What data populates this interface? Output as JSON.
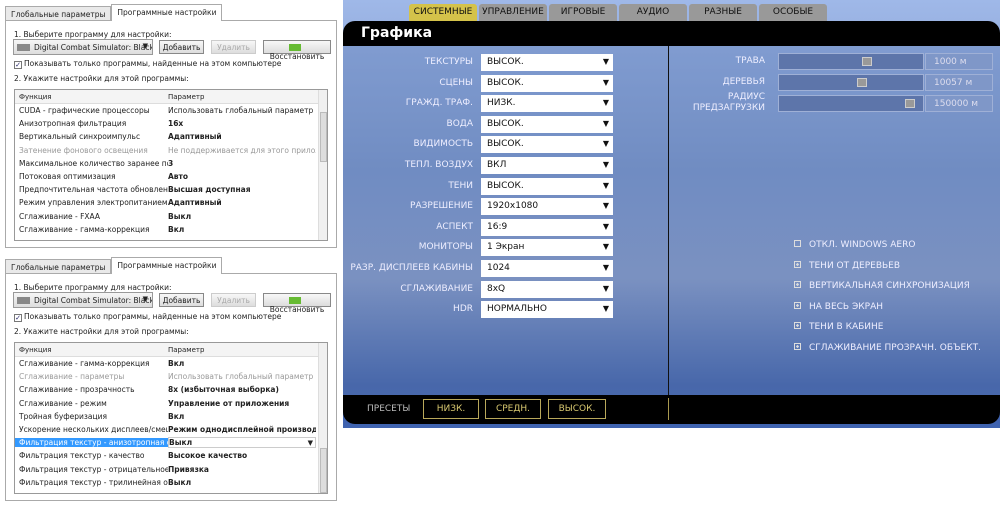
{
  "nvidia_panels": [
    {
      "tabs": [
        "Глобальные параметры",
        "Программные настройки"
      ],
      "step1": "1. Выберите программу для настройки:",
      "program": "Digital Combat Simulator: Black ...",
      "add": "Добавить",
      "remove": "Удалить",
      "restore": "Восстановить",
      "show_only": "Показывать только программы, найденные на этом компьютере",
      "show_only_checked": true,
      "step2": "2. Укажите настройки для этой программы:",
      "col_function": "Функция",
      "col_param": "Параметр",
      "rows": [
        {
          "f": "CUDA - графические процессоры",
          "p": "Использовать глобальный параметр (Все)",
          "style": "normal"
        },
        {
          "f": "Анизотропная фильтрация",
          "p": "16x",
          "style": "bold"
        },
        {
          "f": "Вертикальный синхроимпульс",
          "p": "Адаптивный",
          "style": "bold"
        },
        {
          "f": "Затенение фонового освещения",
          "p": "Не поддерживается для этого приложе...",
          "style": "dim"
        },
        {
          "f": "Максимальное количество заранее под...",
          "p": "3",
          "style": "bold"
        },
        {
          "f": "Потоковая оптимизация",
          "p": "Авто",
          "style": "bold"
        },
        {
          "f": "Предпочтительная частота обновлени...",
          "p": "Высшая доступная",
          "style": "bold"
        },
        {
          "f": "Режим управления электропитанием",
          "p": "Адаптивный",
          "style": "bold"
        },
        {
          "f": "Сглаживание - FXAA",
          "p": "Выкл",
          "style": "bold"
        },
        {
          "f": "Сглаживание - гамма-коррекция",
          "p": "Вкл",
          "style": "bold"
        }
      ]
    },
    {
      "tabs": [
        "Глобальные параметры",
        "Программные настройки"
      ],
      "step1": "1. Выберите программу для настройки:",
      "program": "Digital Combat Simulator: Black ...",
      "add": "Добавить",
      "remove": "Удалить",
      "restore": "Восстановить",
      "show_only": "Показывать только программы, найденные на этом компьютере",
      "show_only_checked": true,
      "step2": "2. Укажите настройки для этой программы:",
      "col_function": "Функция",
      "col_param": "Параметр",
      "rows": [
        {
          "f": "Сглаживание - гамма-коррекция",
          "p": "Вкл",
          "style": "bold"
        },
        {
          "f": "Сглаживание - параметры",
          "p": "Использовать глобальный параметр (У...",
          "style": "dim"
        },
        {
          "f": "Сглаживание - прозрачность",
          "p": "8x (избыточная выборка)",
          "style": "bold"
        },
        {
          "f": "Сглаживание - режим",
          "p": "Управление от приложения",
          "style": "bold"
        },
        {
          "f": "Тройная буферизация",
          "p": "Вкл",
          "style": "bold"
        },
        {
          "f": "Ускорение нескольких дисплеев/смеша...",
          "p": "Режим однодисплейной производи...",
          "style": "bold"
        },
        {
          "f": "Фильтрация текстур - анизотропная оп...",
          "p": "Выкл",
          "style": "selected"
        },
        {
          "f": "Фильтрация текстур - качество",
          "p": "Высокое качество",
          "style": "bold"
        },
        {
          "f": "Фильтрация текстур - отрицательное о...",
          "p": "Привязка",
          "style": "bold"
        },
        {
          "f": "Фильтрация текстур - трилинейная опт...",
          "p": "Выкл",
          "style": "bold"
        }
      ]
    }
  ],
  "game": {
    "tabs": [
      "СИСТЕМНЫЕ",
      "УПРАВЛЕНИЕ",
      "ИГРОВЫЕ",
      "АУДИО",
      "РАЗНЫЕ",
      "ОСОБЫЕ"
    ],
    "active_tab": "СИСТЕМНЫЕ",
    "title": "Графика",
    "settings": [
      {
        "label": "ТЕКСТУРЫ",
        "value": "ВЫСОК."
      },
      {
        "label": "СЦЕНЫ",
        "value": "ВЫСОК."
      },
      {
        "label": "ГРАЖД. ТРАФ.",
        "value": "НИЗК."
      },
      {
        "label": "ВОДА",
        "value": "ВЫСОК."
      },
      {
        "label": "ВИДИМОСТЬ",
        "value": "ВЫСОК."
      },
      {
        "label": "ТЕПЛ. ВОЗДУХ",
        "value": "ВКЛ"
      },
      {
        "label": "ТЕНИ",
        "value": "ВЫСОК."
      },
      {
        "label": "РАЗРЕШЕНИЕ",
        "value": "1920x1080"
      },
      {
        "label": "АСПЕКТ",
        "value": "16:9"
      },
      {
        "label": "МОНИТОРЫ",
        "value": "1 Экран"
      },
      {
        "label": "РАЗР. ДИСПЛЕЕВ КАБИНЫ",
        "value": "1024"
      },
      {
        "label": "СГЛАЖИВАНИЕ",
        "value": "8xQ"
      },
      {
        "label": "HDR",
        "value": "НОРМАЛЬНО"
      }
    ],
    "sliders": [
      {
        "label": "ТРАВА",
        "value": "1000 м",
        "fraction": 0.62
      },
      {
        "label": "ДЕРЕВЬЯ",
        "value": "10057 м",
        "fraction": 0.58
      },
      {
        "label": "РАДИУС ПРЕДЗАГРУЗКИ",
        "value": "150000 м",
        "fraction": 0.94
      }
    ],
    "checkboxes": [
      {
        "label": "ОТКЛ. WINDOWS AERO",
        "checked": false
      },
      {
        "label": "ТЕНИ ОТ ДЕРЕВЬЕВ",
        "checked": true
      },
      {
        "label": "ВЕРТИКАЛЬНАЯ СИНХРОНИЗАЦИЯ",
        "checked": true
      },
      {
        "label": "НА ВЕСЬ ЭКРАН",
        "checked": true
      },
      {
        "label": "ТЕНИ В КАБИНЕ",
        "checked": true
      },
      {
        "label": "СГЛАЖИВАНИЕ ПРОЗРАЧН. ОБЪЕКТ.",
        "checked": true
      }
    ],
    "presets_label": "ПРЕСЕТЫ",
    "presets": [
      "НИЗК.",
      "СРЕДН.",
      "ВЫСОК."
    ]
  }
}
